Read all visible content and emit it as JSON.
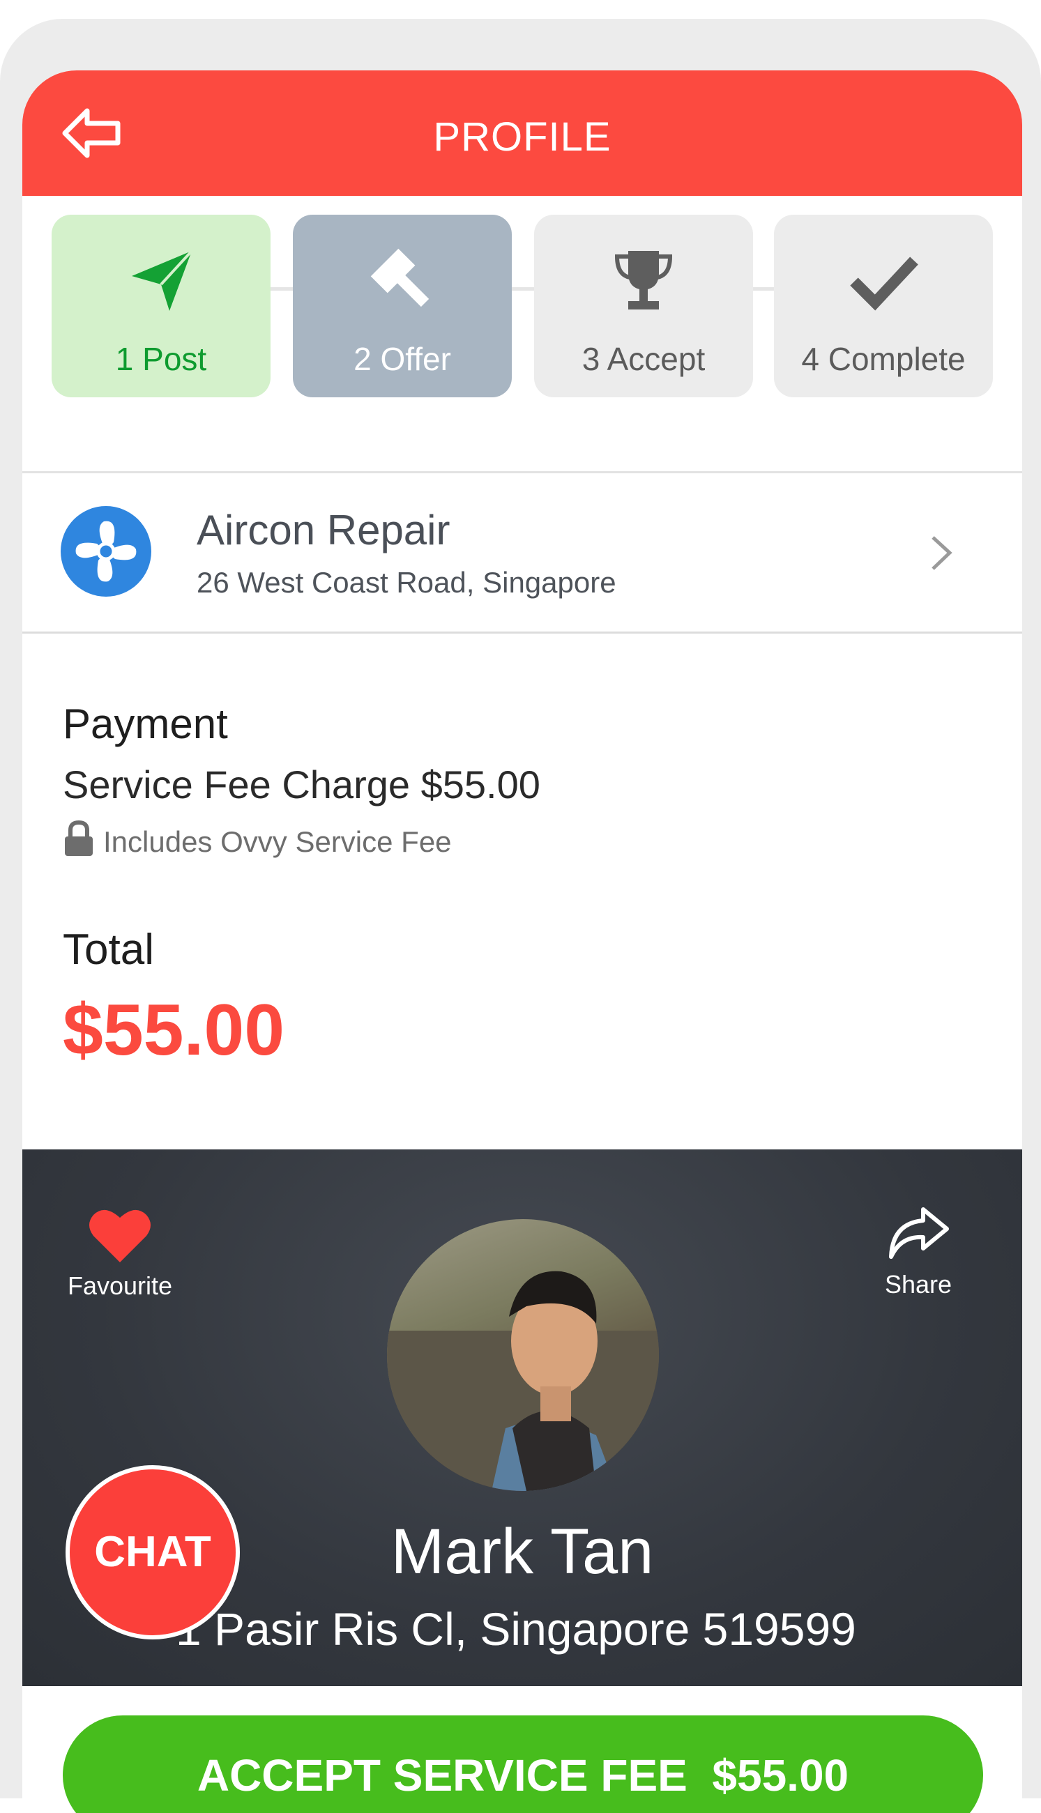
{
  "nav": {
    "title": "PROFILE"
  },
  "steps": [
    {
      "label": "1 Post"
    },
    {
      "label": "2 Offer"
    },
    {
      "label": "3 Accept"
    },
    {
      "label": "4 Complete"
    }
  ],
  "job": {
    "name": "Aircon Repair",
    "address": "26 West Coast Road, Singapore"
  },
  "payment": {
    "heading": "Payment",
    "fee_line": "Service Fee Charge $55.00",
    "note": "Includes Ovvy Service Fee",
    "total_heading": "Total",
    "total_value": "$55.00"
  },
  "profile": {
    "favourite_label": "Favourite",
    "share_label": "Share",
    "name": "Mark Tan",
    "address": "1 Pasir Ris Cl, Singapore 519599"
  },
  "chat": {
    "label": "CHAT"
  },
  "accept": {
    "label": "ACCEPT SERVICE FEE  $55.00"
  },
  "colors": {
    "accent": "#fc4a40",
    "green": "#47bd1d",
    "step_done_bg": "#d4f1cb",
    "step_active_bg": "#a8b5c2"
  },
  "icons": [
    "back-arrow-icon",
    "paper-plane-icon",
    "gavel-icon",
    "trophy-icon",
    "checkmark-icon",
    "fan-icon",
    "chevron-right-icon",
    "lock-icon",
    "heart-icon",
    "share-arrow-icon"
  ]
}
